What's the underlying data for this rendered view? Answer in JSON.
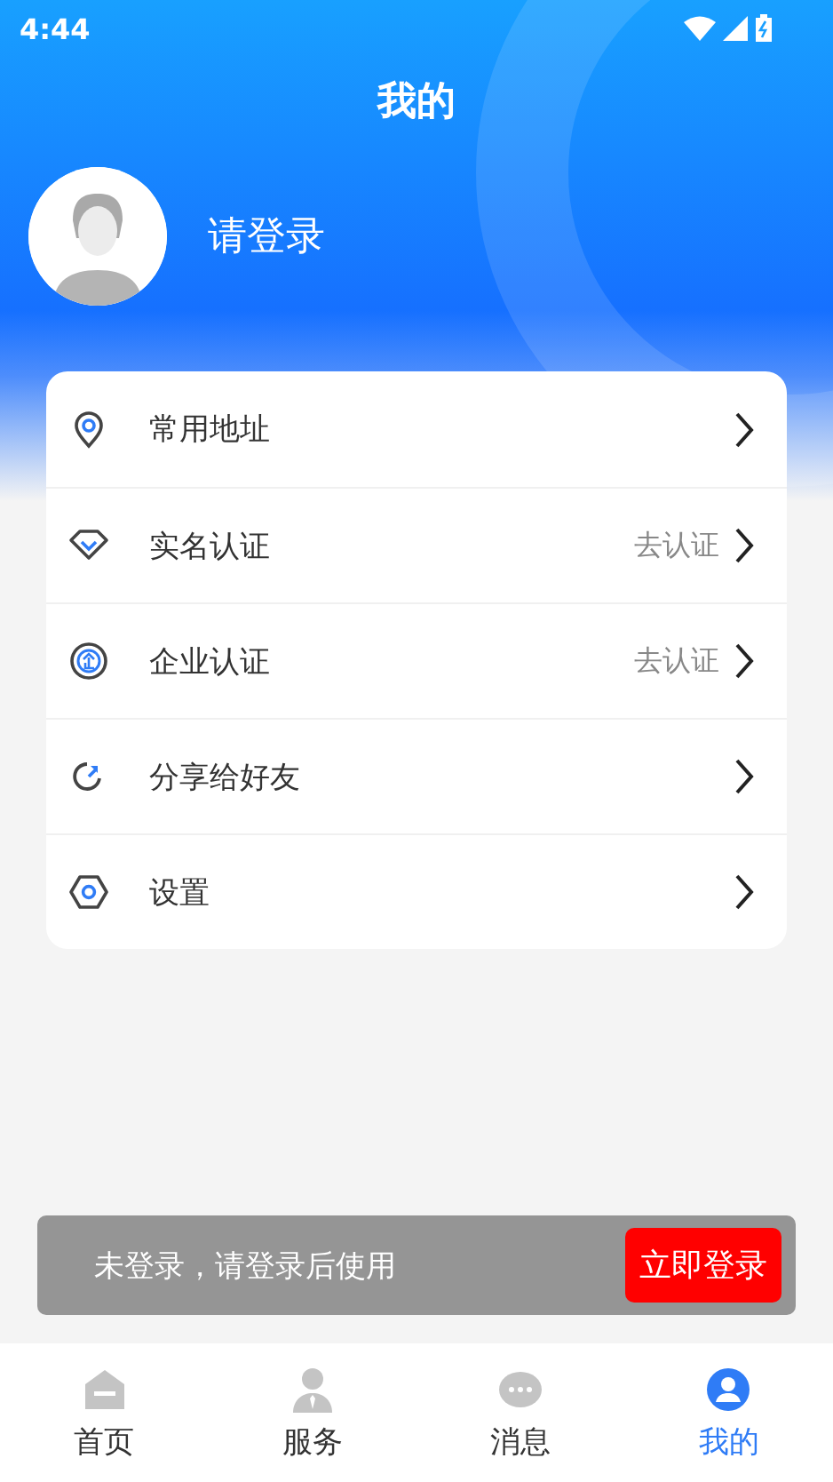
{
  "status_bar": {
    "time": "4:44"
  },
  "header": {
    "title": "我的"
  },
  "profile": {
    "name": "请登录"
  },
  "menu": [
    {
      "label": "常用地址"
    },
    {
      "label": "实名认证",
      "hint": "去认证"
    },
    {
      "label": "企业认证",
      "hint": "去认证"
    },
    {
      "label": "分享给好友"
    },
    {
      "label": "设置"
    }
  ],
  "login_banner": {
    "message": "未登录，请登录后使用",
    "button": "立即登录"
  },
  "tabs": [
    {
      "label": "首页",
      "selected": false
    },
    {
      "label": "服务",
      "selected": false
    },
    {
      "label": "消息",
      "selected": false
    },
    {
      "label": "我的",
      "selected": true
    }
  ]
}
